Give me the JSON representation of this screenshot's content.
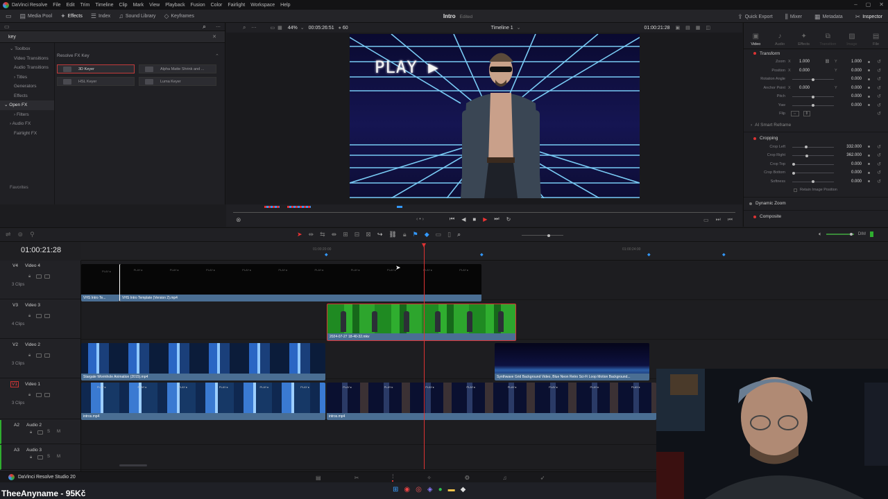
{
  "menubar": {
    "app": "DaVinci Resolve",
    "items": [
      "File",
      "Edit",
      "Trim",
      "Timeline",
      "Clip",
      "Mark",
      "View",
      "Playback",
      "Fusion",
      "Color",
      "Fairlight",
      "Workspace",
      "Help"
    ]
  },
  "toolbar": {
    "left": [
      "Media Pool",
      "Effects",
      "Index",
      "Sound Library",
      "Keyframes"
    ],
    "project_title": "Intro",
    "project_status": "Edited",
    "right": [
      "Quick Export",
      "Mixer",
      "Metadata",
      "Inspector"
    ]
  },
  "viewer": {
    "zoom": "44%",
    "source_timecode": "00:05:26:51",
    "fps": "60",
    "timeline_name": "Timeline 1",
    "record_timecode": "01:00:21:28",
    "clip_name": "2024-07-27 18-40-32.mkv",
    "overlay_text": "PLAY ▶"
  },
  "effects": {
    "search": "key",
    "tree": [
      {
        "label": "Toolbox",
        "level": 0
      },
      {
        "label": "Video Transitions",
        "level": 1
      },
      {
        "label": "Audio Transitions",
        "level": 1
      },
      {
        "label": "Titles",
        "level": 1
      },
      {
        "label": "Generators",
        "level": 1
      },
      {
        "label": "Effects",
        "level": 1
      },
      {
        "label": "Open FX",
        "level": 0,
        "active": true
      },
      {
        "label": "Filters",
        "level": 1
      },
      {
        "label": "Audio FX",
        "level": 0
      },
      {
        "label": "Fairlight FX",
        "level": 1
      }
    ],
    "group_title": "Resolve FX Key",
    "items": [
      "3D Keyer",
      "Alpha Matte Shrink and ...",
      "HSL Keyer",
      "Luma Keyer"
    ],
    "favorites": "Favorites"
  },
  "inspector": {
    "tabs": [
      "Video",
      "Audio",
      "Effects",
      "Transition",
      "Image",
      "File"
    ],
    "transform": {
      "title": "Transform",
      "zoom_x": "1.000",
      "zoom_y": "1.000",
      "position_x": "0.000",
      "position_y": "0.000",
      "rotation": "0.000",
      "anchor_x": "0.000",
      "anchor_y": "0.000",
      "pitch": "0.000",
      "yaw": "0.000",
      "labels": [
        "Zoom",
        "Position",
        "Rotation Angle",
        "Anchor Point",
        "Pitch",
        "Yaw",
        "Flip"
      ]
    },
    "ai_reframe": "AI Smart Reframe",
    "cropping": {
      "title": "Cropping",
      "rows": [
        {
          "label": "Crop Left",
          "value": "332.000",
          "pos": 0.32
        },
        {
          "label": "Crop Right",
          "value": "362.000",
          "pos": 0.34
        },
        {
          "label": "Crop Top",
          "value": "0.000",
          "pos": 0.0
        },
        {
          "label": "Crop Bottom",
          "value": "0.000",
          "pos": 0.0
        },
        {
          "label": "Softness",
          "value": "0.000",
          "pos": 0.5
        }
      ],
      "retain": "Retain Image Position"
    },
    "dynamic_zoom": "Dynamic Zoom",
    "composite": "Composite",
    "xy": {
      "x": "X",
      "y": "Y"
    }
  },
  "timeline": {
    "timecode": "01:00:21:28",
    "ruler": [
      "01:00:20:00",
      "01:00:24:00"
    ],
    "audio_monitor": "DIM",
    "tracks": [
      {
        "id": "V4",
        "name": "Video 4",
        "clips": "3 Clips"
      },
      {
        "id": "V3",
        "name": "Video 3",
        "clips": "4 Clips"
      },
      {
        "id": "V2",
        "name": "Video 2",
        "clips": "3 Clips"
      },
      {
        "id": "V1",
        "name": "Video 1",
        "clips": "3 Clips"
      },
      {
        "id": "A2",
        "name": "Audio 2",
        "clips": ""
      },
      {
        "id": "A3",
        "name": "Audio 3",
        "clips": ""
      }
    ],
    "clip_labels": {
      "v4a": "VHS Intro Te...",
      "v4b": "VHS Intro Template (Version 2).mp4",
      "v3": "2024-07-27 18-40-32.mkv",
      "v2a": "Stargate Wormhole Animation (2015).mp4",
      "v2b": "Synthwave Grid Background Video, Blue Neon Retro Sci-Fi Loop Motion Background...",
      "v1a": "intros.mp4",
      "v1b": "intros.mp4"
    },
    "thumb_text": "PLAY ▸"
  },
  "footer": {
    "app": "DaVinci Resolve Studio 20"
  },
  "overlay": {
    "donation": "TheeAnyname - 95Kč"
  },
  "colors": {
    "accent": "#d33b3b",
    "clip_label": "#4a6e93",
    "green": "#2fae2f"
  }
}
